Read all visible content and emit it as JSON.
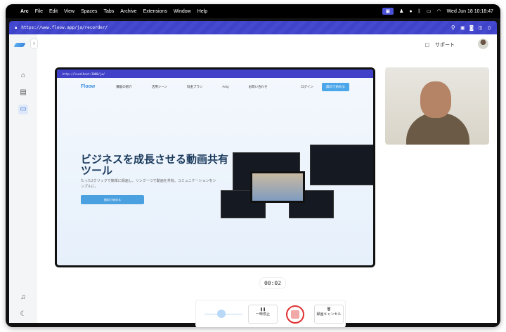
{
  "menubar": {
    "app": "Arc",
    "items": [
      "File",
      "Edit",
      "View",
      "Spaces",
      "Tabs",
      "Archive",
      "Extensions",
      "Window",
      "Help"
    ],
    "clock": "Wed Jun 18  10:18:47"
  },
  "browser": {
    "url": "https://www.floow.app/ja/recorder/"
  },
  "header": {
    "support": "サポート"
  },
  "preview": {
    "url": "http://localhost:3000/ja/",
    "brand": "Floow",
    "nav": [
      "機能の紹介",
      "活用シーン",
      "料金プラン",
      "FAQ",
      "お問い合わせ"
    ],
    "login": "ログイン",
    "signup": "無料で始める",
    "headline": "ビジネスを成長させる動画共有ツール",
    "subtext": "たった2クリックで簡単に録画し、リンク一つで動画を共有。コミュニケーションをシンプルに。",
    "cta": "無料で始める"
  },
  "recorder": {
    "timer": "00:02",
    "pause": "一時停止",
    "cancel": "録画キャンセル"
  }
}
